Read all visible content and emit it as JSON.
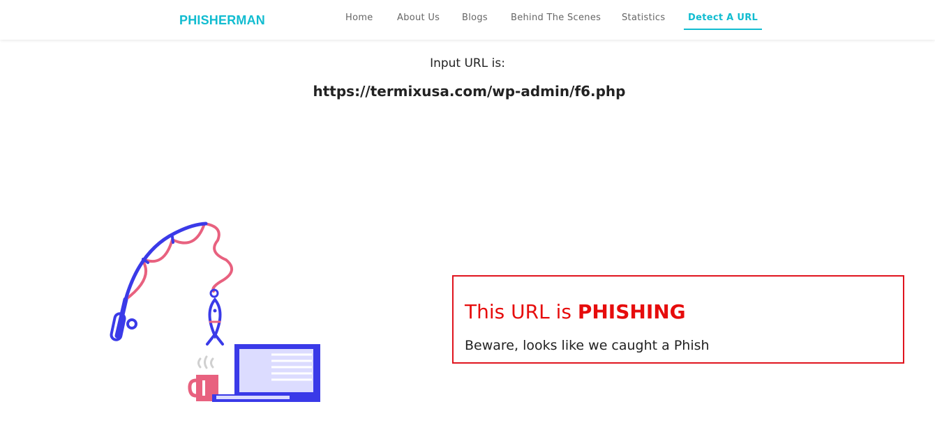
{
  "brand": "PHISHERMAN",
  "nav": {
    "items": [
      "Home",
      "About Us",
      "Blogs",
      "Behind The Scenes",
      "Statistics",
      "Detect A URL"
    ],
    "active_index": 5
  },
  "main": {
    "input_label": "Input URL is:",
    "input_url": "https://termixusa.com/wp-admin/f6.php"
  },
  "result": {
    "title_prefix": "This URL is ",
    "title_verdict": "PHISHING",
    "subtitle": "Beware, looks like we caught a Phish"
  },
  "colors": {
    "accent": "#11bcd0",
    "danger": "#e60c0c",
    "rod_blue": "#3a3ae8",
    "line_pink": "#e8617f",
    "laptop_screen": "#dcdcff"
  },
  "icons": {
    "illustration": "fishing-rod-laptop-illustration"
  }
}
